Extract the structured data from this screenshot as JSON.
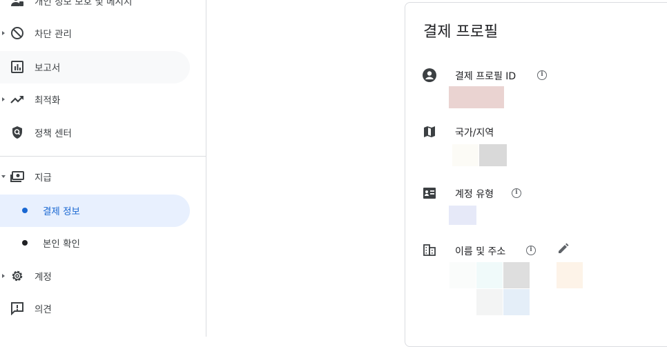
{
  "sidebar": {
    "items": [
      {
        "label": "개인 정보 보호 및 메시지",
        "icon": "privacy-icon"
      },
      {
        "label": "차단 관리",
        "icon": "block-icon"
      },
      {
        "label": "보고서",
        "icon": "report-icon"
      },
      {
        "label": "최적화",
        "icon": "trending-up-icon"
      },
      {
        "label": "정책 센터",
        "icon": "policy-shield-icon"
      },
      {
        "label": "지급",
        "icon": "payments-icon"
      },
      {
        "label": "결제 정보",
        "icon": "bullet-icon"
      },
      {
        "label": "본인 확인",
        "icon": "bullet-icon"
      },
      {
        "label": "계정",
        "icon": "gear-icon"
      },
      {
        "label": "의견",
        "icon": "feedback-icon"
      }
    ]
  },
  "card": {
    "title": "결제 프로필",
    "rows": [
      {
        "label": "결제 프로필 ID",
        "icon": "account-circle-icon"
      },
      {
        "label": "국가/지역",
        "icon": "map-icon"
      },
      {
        "label": "계정 유형",
        "icon": "id-card-icon"
      },
      {
        "label": "이름 및 주소",
        "icon": "business-icon"
      }
    ]
  },
  "colors": {
    "accent": "#1967d2",
    "active_bg": "#e8f0fe",
    "icon": "#3c4043",
    "redacted_id": "#ead3d1",
    "redacted_type": "#e6e9f8"
  }
}
